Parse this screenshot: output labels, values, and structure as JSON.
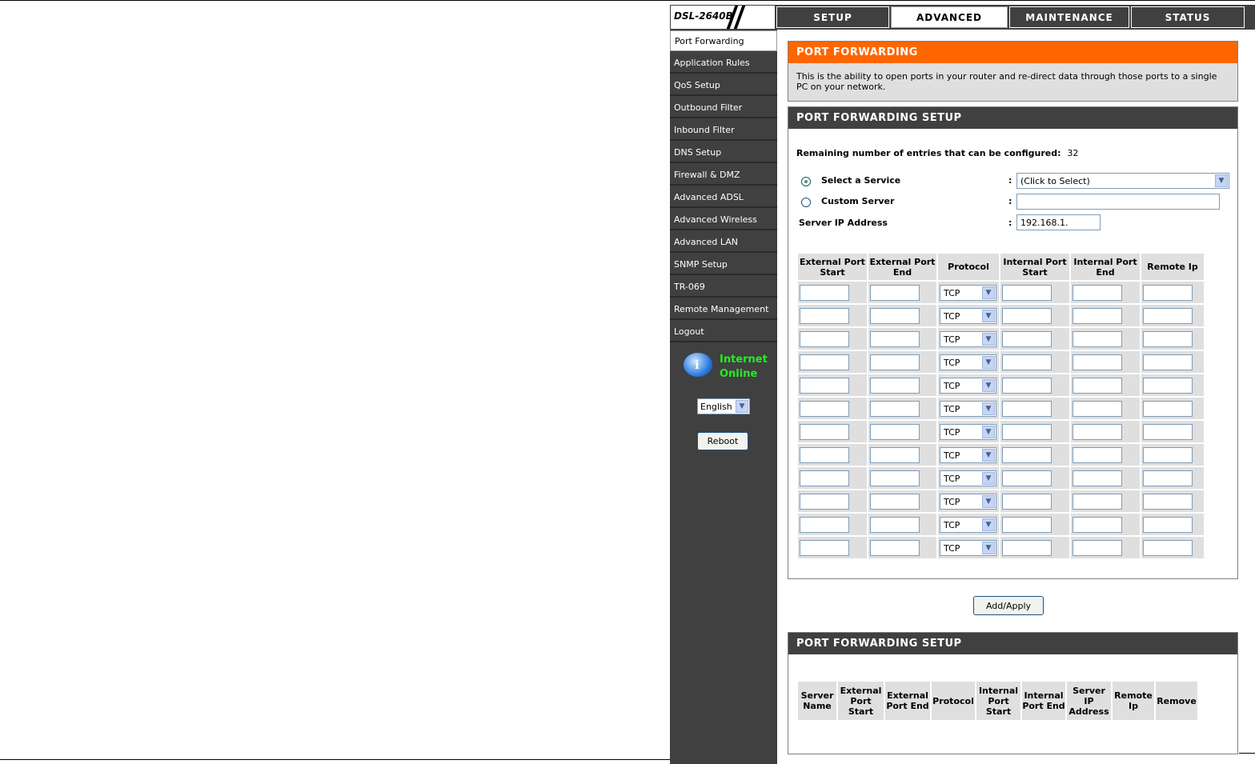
{
  "device": {
    "model": "DSL-2640B"
  },
  "tabs": [
    {
      "label": "SETUP",
      "active": false
    },
    {
      "label": "ADVANCED",
      "active": true
    },
    {
      "label": "MAINTENANCE",
      "active": false
    },
    {
      "label": "STATUS",
      "active": false
    }
  ],
  "sidebar": {
    "items": [
      {
        "label": "Port Forwarding",
        "active": true
      },
      {
        "label": "Application Rules"
      },
      {
        "label": "QoS Setup"
      },
      {
        "label": "Outbound Filter"
      },
      {
        "label": "Inbound Filter"
      },
      {
        "label": "DNS Setup"
      },
      {
        "label": "Firewall & DMZ"
      },
      {
        "label": "Advanced ADSL"
      },
      {
        "label": "Advanced Wireless"
      },
      {
        "label": "Advanced LAN"
      },
      {
        "label": "SNMP Setup"
      },
      {
        "label": "TR-069"
      },
      {
        "label": "Remote Management"
      },
      {
        "label": "Logout"
      }
    ],
    "status_line1": "Internet",
    "status_line2": "Online",
    "language": "English",
    "reboot_label": "Reboot"
  },
  "intro": {
    "title": "PORT FORWARDING",
    "text": "This is the ability to open ports in your router and re-direct data through those ports to a single PC on your network."
  },
  "setup": {
    "title": "PORT FORWARDING SETUP",
    "remaining_label": "Remaining number of entries that can be configured:",
    "remaining_value": "32",
    "select_service_label": "Select a Service",
    "select_service_value": "(Click to Select)",
    "custom_server_label": "Custom Server",
    "custom_server_value": "",
    "server_ip_label": "Server IP Address",
    "server_ip_value": "192.168.1.",
    "colon": ":",
    "columns": [
      "External Port Start",
      "External Port End",
      "Protocol",
      "Internal Port Start",
      "Internal Port End",
      "Remote Ip"
    ],
    "protocol_default": "TCP",
    "row_count": 12
  },
  "apply_label": "Add/Apply",
  "list": {
    "title": "PORT FORWARDING SETUP",
    "columns": [
      "Server Name",
      "External Port Start",
      "External Port End",
      "Protocol",
      "Internal Port Start",
      "Internal Port End",
      "Server IP Address",
      "Remote Ip",
      "Remove"
    ]
  },
  "colors": {
    "orange": "#ff6600",
    "dark": "#404040",
    "online": "#22ee22"
  }
}
